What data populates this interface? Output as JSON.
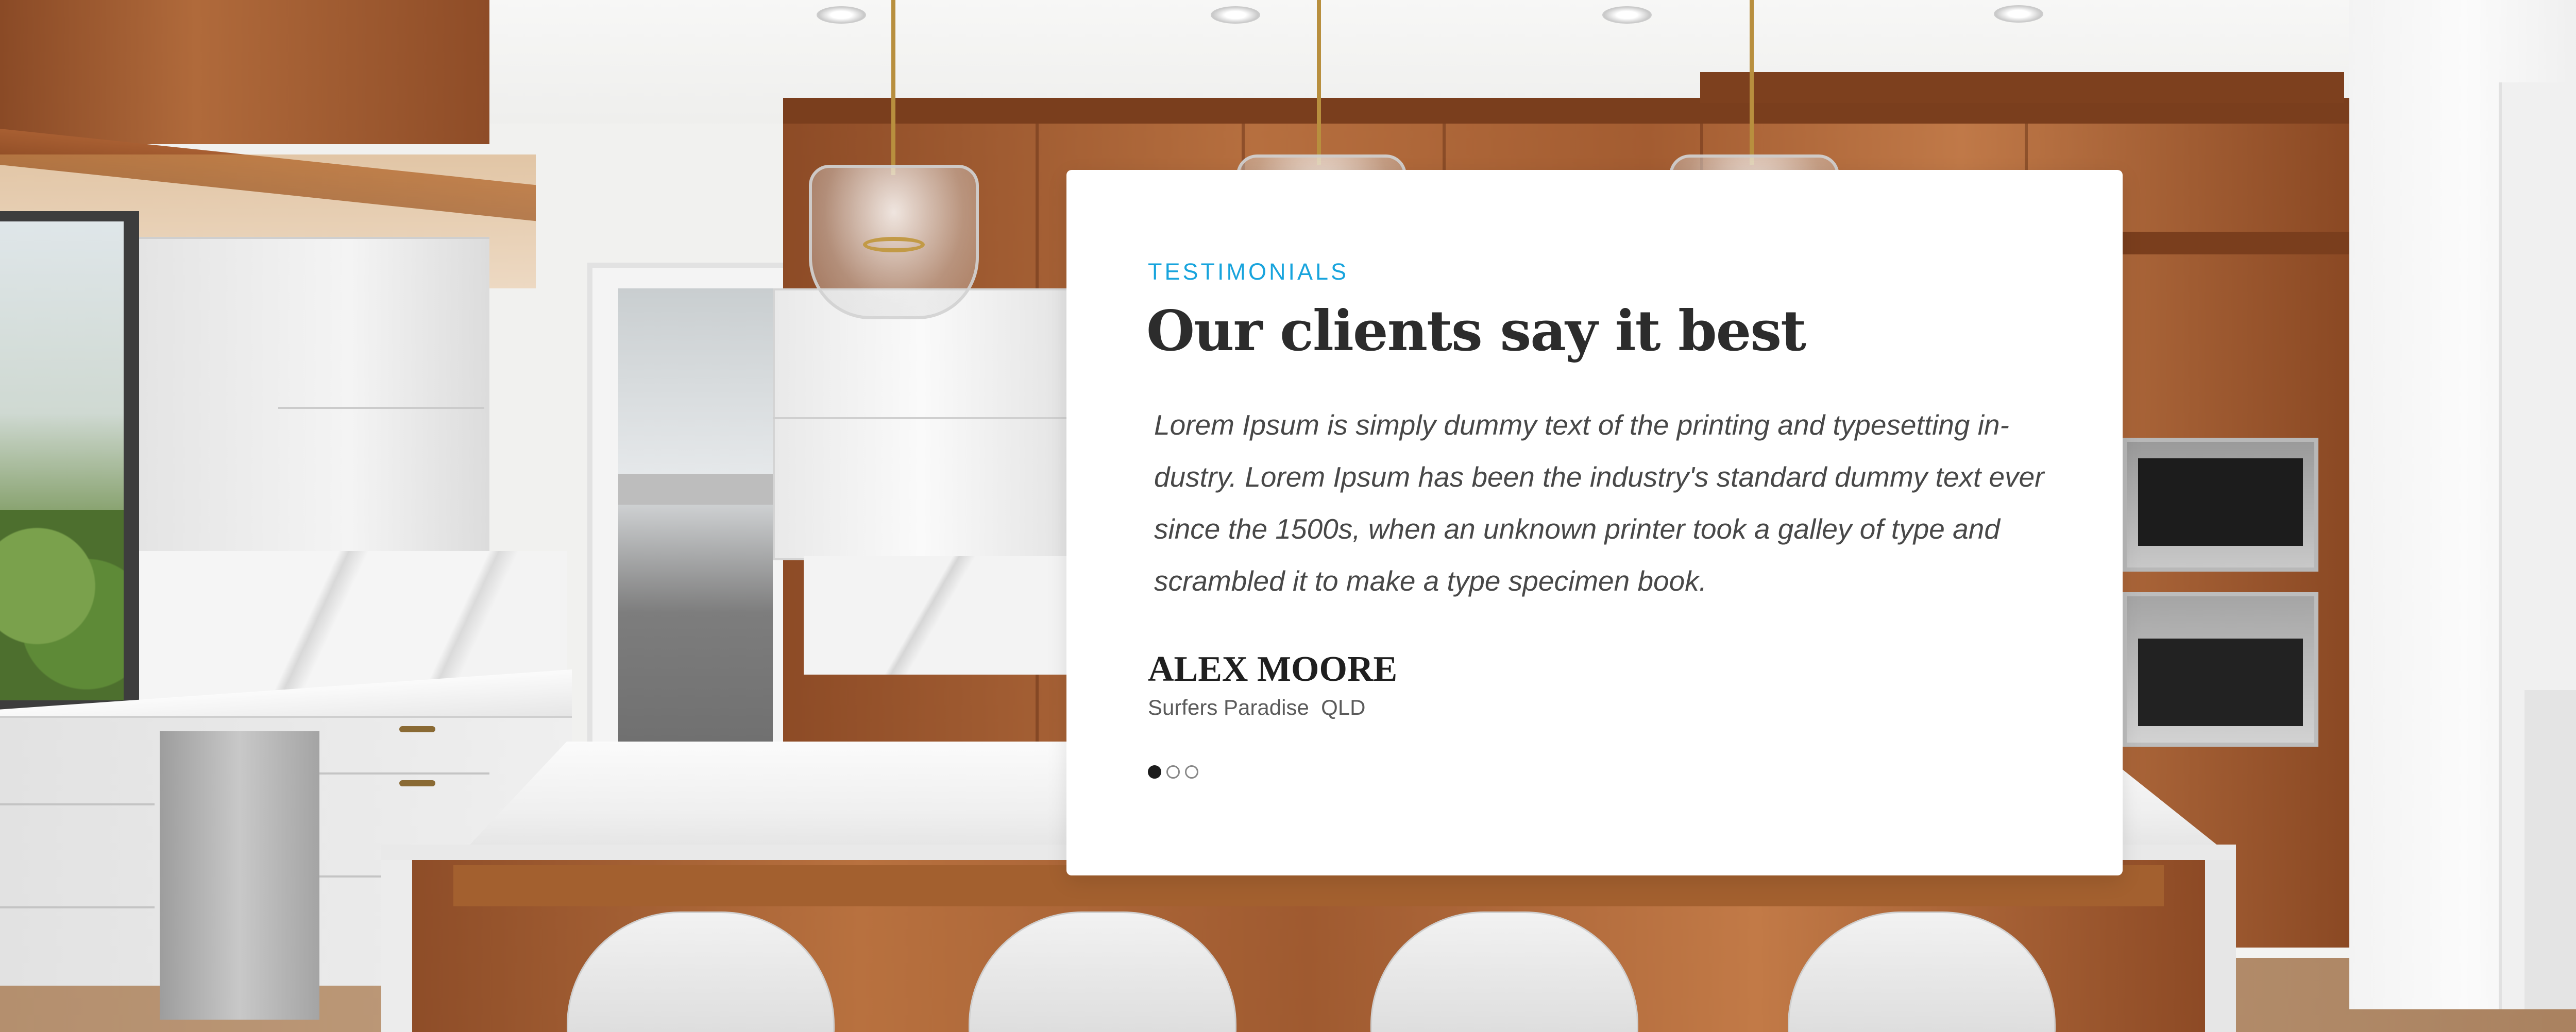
{
  "testimonial": {
    "eyebrow": "TESTIMONIALS",
    "heading": "Our clients say it best",
    "quote": "Lorem Ipsum is simply dummy text of the printing and typesetting in-dustry. Lorem Ipsum has been the industry's standard dummy text ever since the 1500s, when an unknown printer took a galley of type and scrambled it to make a type specimen book.",
    "author_name": "ALEX MOORE",
    "author_location": "Surfers Paradise  QLD",
    "slides": {
      "total": 3,
      "active": 1
    }
  },
  "colors": {
    "accent": "#18a4dd",
    "heading": "#2c2c2c",
    "body": "#484848",
    "card_bg": "#ffffff"
  },
  "icons": {
    "dot_active": "filled-circle",
    "dot_inactive": "hollow-circle"
  }
}
